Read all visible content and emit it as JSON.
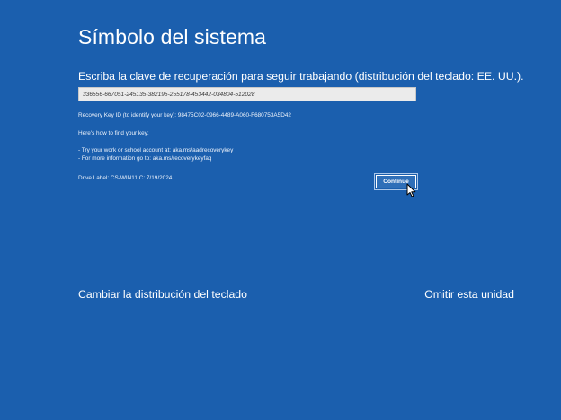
{
  "page": {
    "title": "Símbolo del sistema",
    "prompt": "Escriba la clave de recuperación para seguir trabajando (distribución del teclado: EE. UU.).",
    "background_color": "#1b5fae"
  },
  "recovery": {
    "key_value": "336556-667051-245135-382195-255178-453442-034804-512028",
    "key_id_text": "Recovery Key ID (to identify your key): 98475C02-0966-4489-A060-F680753A5D42",
    "howto_text": "Here's how to find your key:",
    "bullets": [
      "- Try your work or school account at: aka.ms/aadrecoverykey",
      "- For more information go to: aka.ms/recoverykeyfaq"
    ],
    "drive_label": "Drive Label: CS-WIN11 C: 7/19/2024",
    "continue_label": "Continue"
  },
  "footer": {
    "change_layout_label": "Cambiar la distribución del teclado",
    "skip_drive_label": "Omitir esta unidad"
  },
  "icons": {
    "cursor": "mouse-pointer-icon"
  }
}
